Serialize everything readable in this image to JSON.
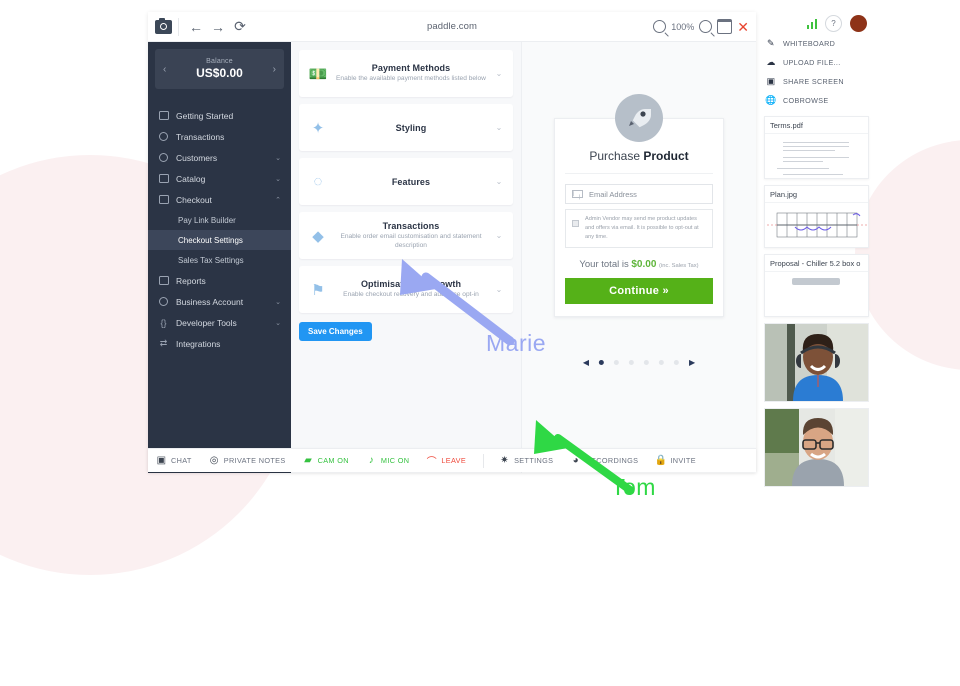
{
  "browser": {
    "url": "paddle.com",
    "zoom_level": "100%",
    "icons": {
      "camera": "camera-icon",
      "back": "←",
      "forward": "→",
      "reload": "⟳",
      "zoom_out": "zoom-out-icon",
      "zoom_in": "zoom-in-icon",
      "minimize": "window-icon",
      "close": "✕"
    }
  },
  "sidebar": {
    "balance": {
      "label": "Balance",
      "value": "US$0.00",
      "prev": "‹",
      "next": "›"
    },
    "items": [
      {
        "label": "Getting Started",
        "icon": "image-icon",
        "caret": ""
      },
      {
        "label": "Transactions",
        "icon": "clock-icon",
        "caret": ""
      },
      {
        "label": "Customers",
        "icon": "users-icon",
        "caret": "⌄"
      },
      {
        "label": "Catalog",
        "icon": "grid-icon",
        "caret": "⌄"
      },
      {
        "label": "Checkout",
        "icon": "card-icon",
        "caret": "⌃"
      }
    ],
    "sub_items": [
      {
        "label": "Pay Link Builder",
        "active": false
      },
      {
        "label": "Checkout Settings",
        "active": true
      },
      {
        "label": "Sales Tax Settings",
        "active": false
      }
    ],
    "items_after": [
      {
        "label": "Reports",
        "icon": "report-icon",
        "caret": ""
      },
      {
        "label": "Business Account",
        "icon": "circle-icon",
        "caret": "⌄"
      },
      {
        "label": "Developer Tools",
        "icon": "code-icon",
        "caret": "⌄"
      },
      {
        "label": "Integrations",
        "icon": "transfer-icon",
        "caret": ""
      }
    ]
  },
  "settings_cards": [
    {
      "title": "Payment Methods",
      "subtitle": "Enable the available payment methods listed below",
      "icon": "money-icon"
    },
    {
      "title": "Styling",
      "subtitle": "",
      "icon": "sparkles-icon"
    },
    {
      "title": "Features",
      "subtitle": "",
      "icon": "check-circle-icon"
    },
    {
      "title": "Transactions",
      "subtitle": "Enable order email customisation and statement description",
      "icon": "layers-icon"
    },
    {
      "title": "Optimisation & Growth",
      "subtitle": "Enable checkout recovery and audience opt-in",
      "icon": "flag-icon"
    }
  ],
  "save_button": "Save Changes",
  "checkout": {
    "title_prefix": "Purchase ",
    "title_strong": "Product",
    "email_placeholder": "Email Address",
    "optin_text": "Admin Vendor may send me product updates and offers via email. It is possible to opt-out at any time.",
    "total_label": "Your total is ",
    "total_value": "$0.00",
    "total_note": "(inc. Sales Tax)",
    "cta": "Continue »",
    "pagination": {
      "prev": "◀",
      "next": "▶",
      "dots": 6,
      "active_index": 0
    }
  },
  "meeting_bar": [
    {
      "label": "CHAT",
      "icon": "chat-icon",
      "color": "gray"
    },
    {
      "label": "PRIVATE NOTES",
      "icon": "eye-off-icon",
      "color": "gray"
    },
    {
      "label": "CAM ON",
      "icon": "camera-icon",
      "color": "green"
    },
    {
      "label": "MIC ON",
      "icon": "mic-icon",
      "color": "green"
    },
    {
      "label": "LEAVE",
      "icon": "phone-down-icon",
      "color": "red"
    },
    {
      "label": "SETTINGS",
      "icon": "gear-icon",
      "color": "gray"
    },
    {
      "label": "RECORDINGS",
      "icon": "record-icon",
      "color": "gray"
    },
    {
      "label": "INVITE",
      "icon": "lock-icon",
      "color": "gray"
    }
  ],
  "rail": {
    "help_label": "?",
    "actions": [
      {
        "label": "WHITEBOARD",
        "icon": "pencil-icon"
      },
      {
        "label": "UPLOAD FILE...",
        "icon": "upload-cloud-icon"
      },
      {
        "label": "SHARE SCREEN",
        "icon": "screen-share-icon"
      },
      {
        "label": "COBROWSE",
        "icon": "globe-icon"
      }
    ],
    "files": [
      {
        "name": "Terms.pdf",
        "type": "document"
      },
      {
        "name": "Plan.jpg",
        "type": "blueprint"
      },
      {
        "name": "Proposal - Chiller 5.2 box o",
        "type": "document"
      }
    ],
    "participants": [
      {
        "name": "woman-with-headset",
        "shirt": "#2b7cd3"
      },
      {
        "name": "man-with-glasses",
        "shirt": "#9aa3ad"
      }
    ]
  },
  "annotations": [
    {
      "name": "Marie",
      "color": "#9aa8f2"
    },
    {
      "name": "Tom",
      "color": "#2fd845"
    }
  ],
  "colors": {
    "sidebar_bg": "#2b3445",
    "accent_blue": "#2196f3",
    "cta_green": "#55b118",
    "blob_pink": "#fbf0f1"
  }
}
